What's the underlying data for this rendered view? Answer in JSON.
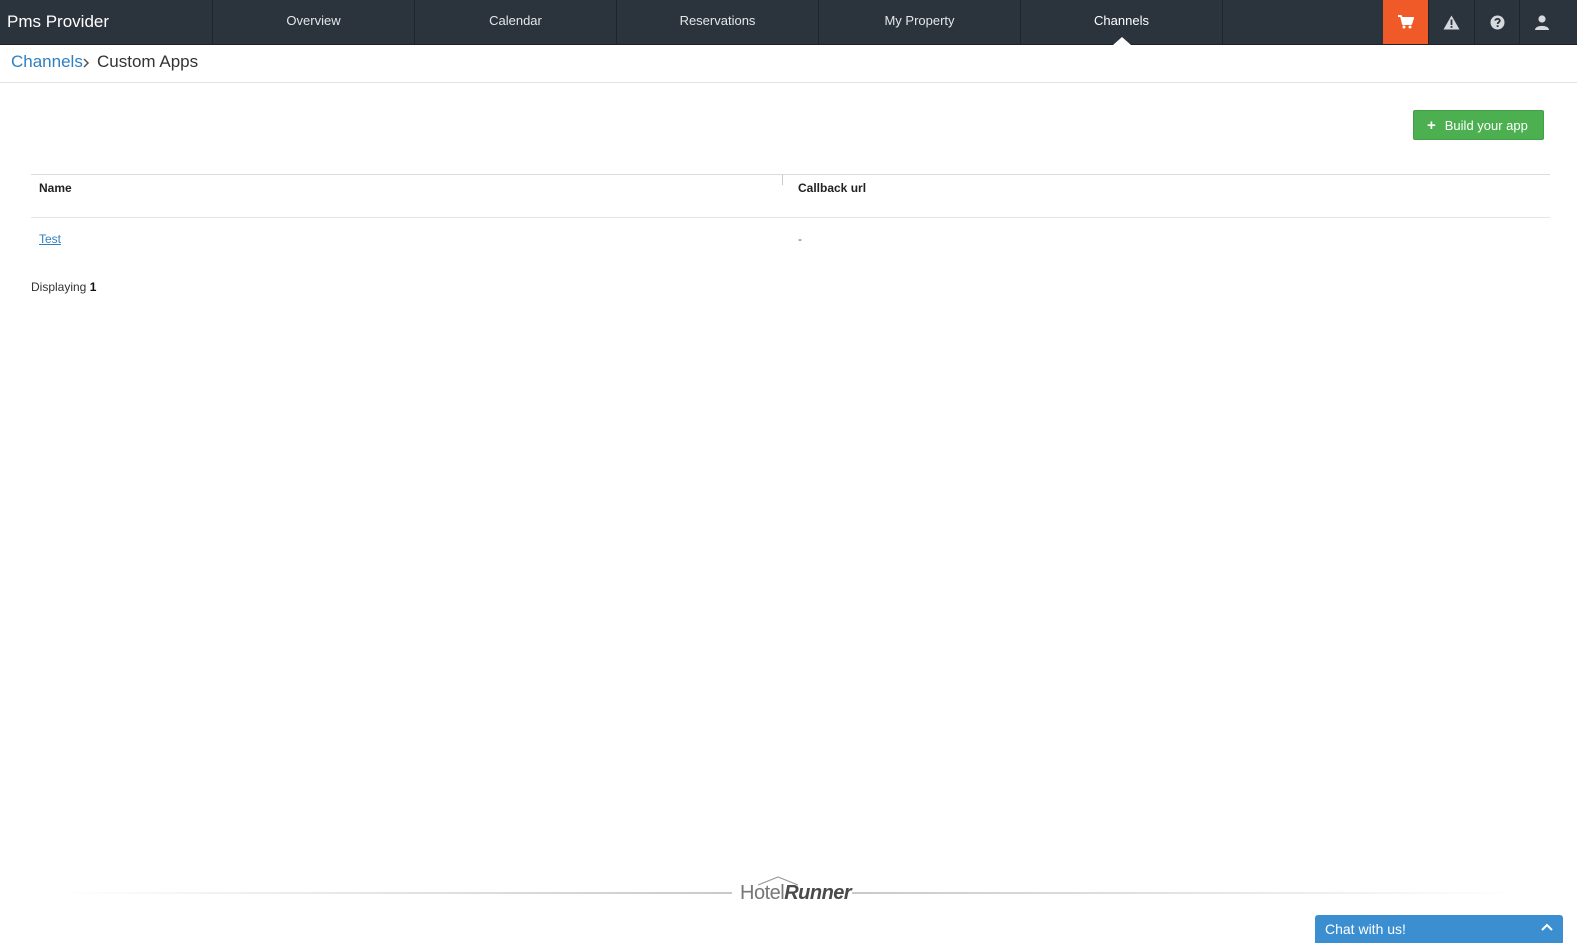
{
  "app": {
    "brand": "Pms Provider"
  },
  "nav": {
    "tabs": [
      {
        "label": "Overview"
      },
      {
        "label": "Calendar"
      },
      {
        "label": "Reservations"
      },
      {
        "label": "My Property"
      },
      {
        "label": "Channels",
        "active": true
      }
    ],
    "icons": [
      "cart-icon",
      "warning-icon",
      "help-icon",
      "user-icon"
    ]
  },
  "breadcrumb": {
    "parent": "Channels",
    "current": "Custom Apps"
  },
  "actions": {
    "build_label": "Build your app"
  },
  "table": {
    "headers": {
      "name": "Name",
      "callback": "Callback url"
    },
    "rows": [
      {
        "name": "Test",
        "callback": "-"
      }
    ]
  },
  "pagination": {
    "prefix": "Displaying",
    "count": "1"
  },
  "footer": {
    "logo_part1": "Hotel",
    "logo_part2": "Runner"
  },
  "chat": {
    "label": "Chat with us!"
  },
  "colors": {
    "topbar": "#2b333d",
    "cart": "#f05a28",
    "primary_button": "#4caf50",
    "link": "#2f7fc1",
    "chat": "#3b8fd0"
  }
}
